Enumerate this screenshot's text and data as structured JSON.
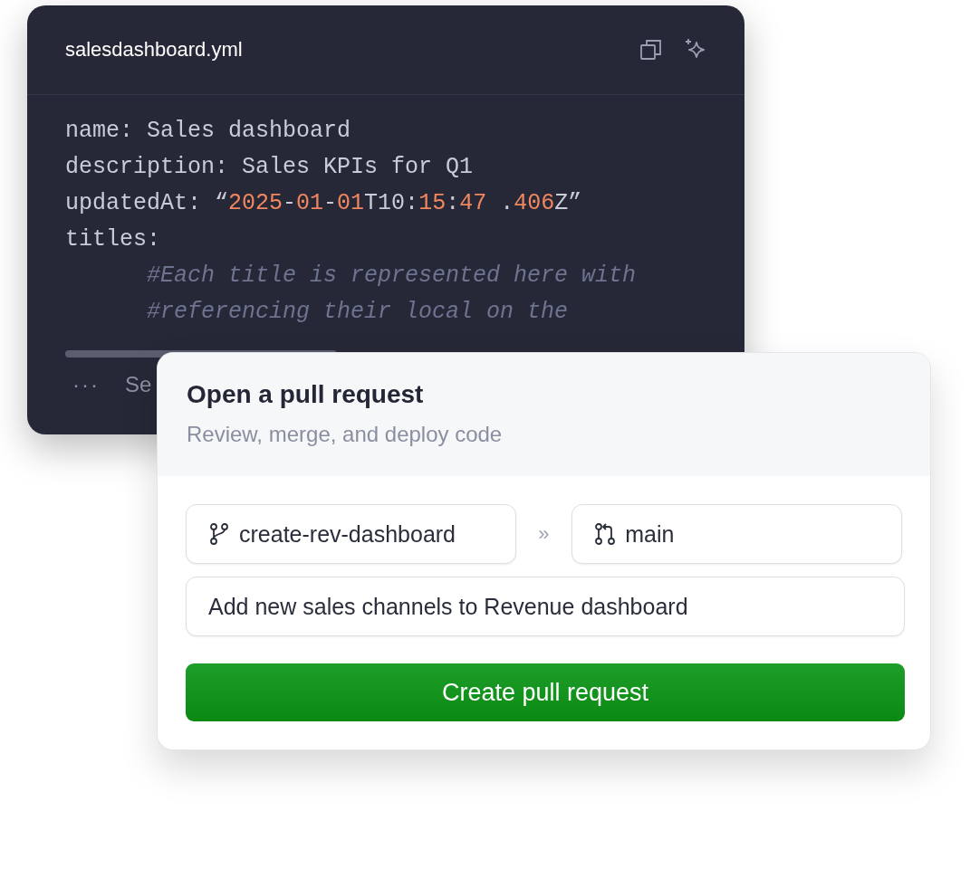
{
  "editor": {
    "filename": "salesdashboard.yml",
    "lines": [
      {
        "segments": [
          {
            "kind": "plain",
            "text": "name: Sales dashboard"
          }
        ]
      },
      {
        "segments": [
          {
            "kind": "plain",
            "text": "description: Sales KPIs for Q1"
          }
        ]
      },
      {
        "segments": [
          {
            "kind": "plain",
            "text": "updatedAt: “"
          },
          {
            "kind": "number",
            "text": "2025"
          },
          {
            "kind": "plain",
            "text": "-"
          },
          {
            "kind": "number",
            "text": "01"
          },
          {
            "kind": "plain",
            "text": "-"
          },
          {
            "kind": "number",
            "text": "01"
          },
          {
            "kind": "plain",
            "text": "T10:"
          },
          {
            "kind": "number",
            "text": "15"
          },
          {
            "kind": "plain",
            "text": ":"
          },
          {
            "kind": "number",
            "text": "47"
          },
          {
            "kind": "plain",
            "text": " ."
          },
          {
            "kind": "number",
            "text": "406"
          },
          {
            "kind": "plain",
            "text": "Z”"
          }
        ]
      },
      {
        "segments": [
          {
            "kind": "plain",
            "text": "titles:"
          }
        ],
        "children": [
          {
            "segments": [
              {
                "kind": "comment",
                "text": "#Each title is represented here with"
              }
            ]
          },
          {
            "segments": [
              {
                "kind": "comment",
                "text": "#referencing their local on the"
              }
            ]
          }
        ]
      }
    ],
    "footer": {
      "more": "···",
      "label": "Se"
    }
  },
  "dialog": {
    "title": "Open a pull request",
    "subtitle": "Review, merge, and deploy code",
    "source_branch": "create-rev-dashboard",
    "separator": "»",
    "target_branch": "main",
    "pr_title": "Add new sales channels to Revenue dashboard",
    "button": "Create pull request"
  }
}
